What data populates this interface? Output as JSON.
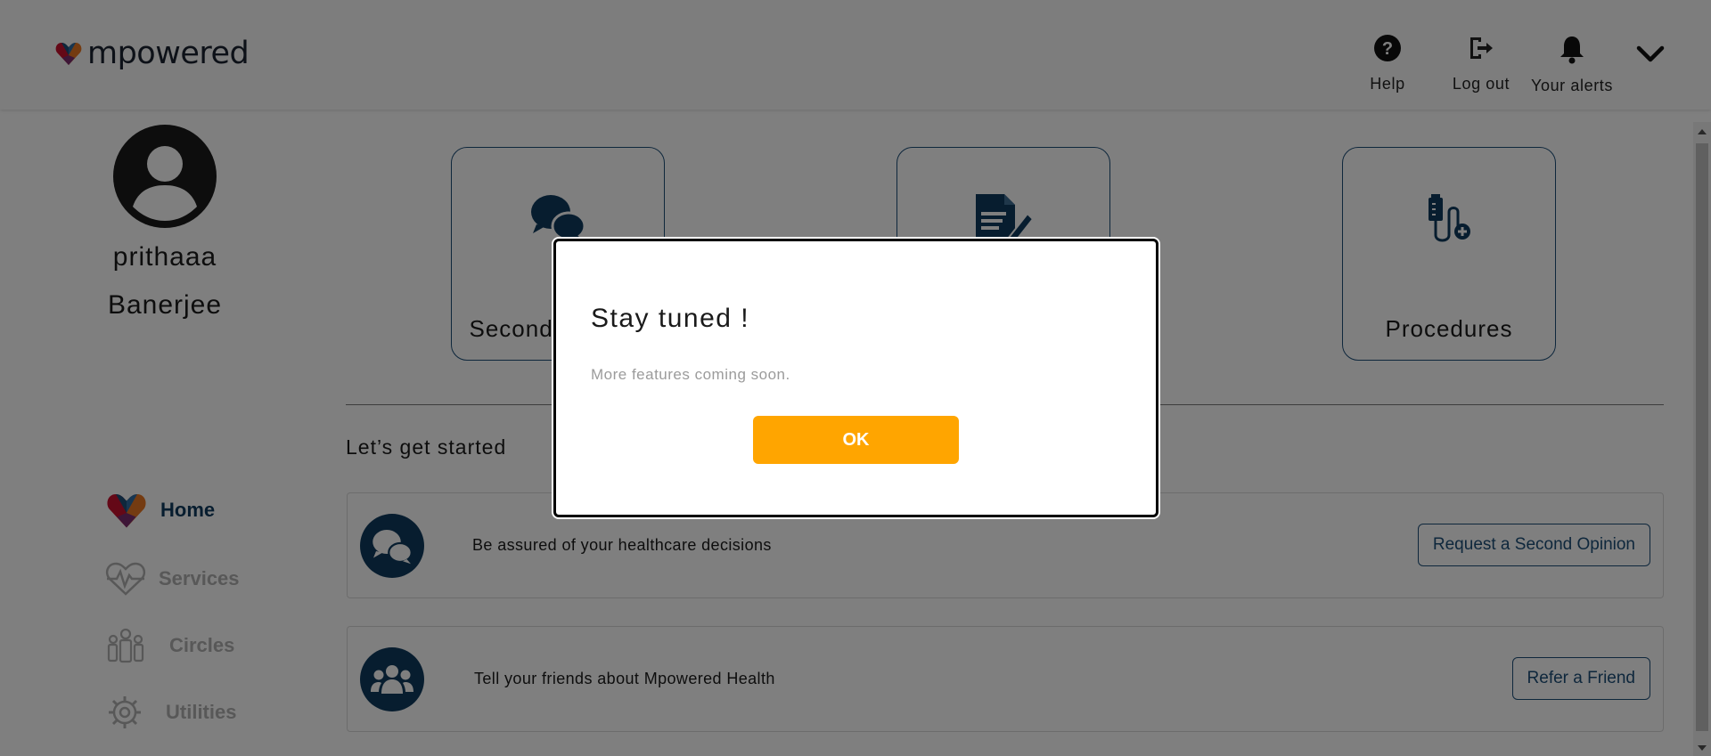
{
  "header": {
    "logo_text": "mpowered",
    "help_label": "Help",
    "logout_label": "Log out",
    "alerts_label": "Your alerts"
  },
  "profile": {
    "first_name": "prithaaa",
    "last_name": "Banerjee"
  },
  "cards": [
    {
      "label": "Second Opinion",
      "icon": "chat-bubbles-icon"
    },
    {
      "label": "",
      "icon": "document-edit-icon"
    },
    {
      "label": "Procedures",
      "icon": "iv-drip-icon"
    }
  ],
  "section_title": "Let’s get started",
  "rows": [
    {
      "text": "Be assured of your healthcare decisions",
      "button": "Request a Second Opinion",
      "icon": "chat-bubbles-icon"
    },
    {
      "text": "Tell your friends about Mpowered Health",
      "button": "Refer a Friend",
      "icon": "group-icon"
    }
  ],
  "nav": {
    "items": [
      {
        "label": "Home",
        "icon": "heart-logo-icon",
        "active": true
      },
      {
        "label": "Services",
        "icon": "heartbeat-icon",
        "active": false
      },
      {
        "label": "Circles",
        "icon": "people-icon",
        "active": false
      },
      {
        "label": "Utilities",
        "icon": "gear-icon",
        "active": false
      }
    ]
  },
  "colors": {
    "brand_navy": "#0f3a5e",
    "accent_orange": "#ffa500",
    "nav_inactive": "#b0b0b0"
  },
  "modal": {
    "title": "Stay tuned !",
    "body": "More features coming soon.",
    "ok_label": "OK"
  }
}
